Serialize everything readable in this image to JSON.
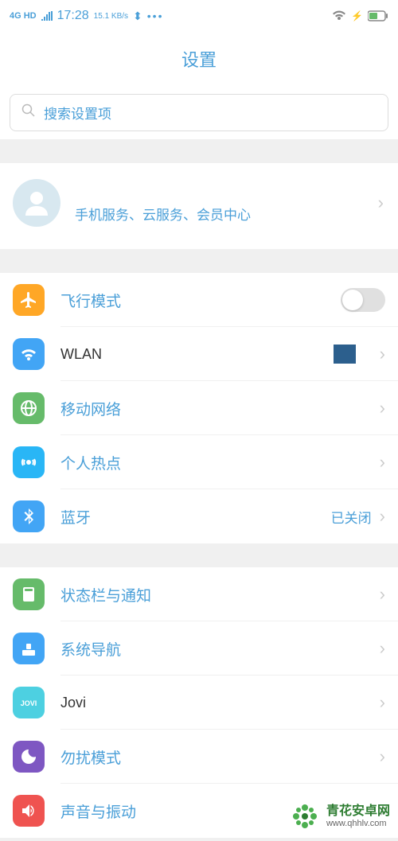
{
  "status": {
    "signal": "4G HD",
    "time": "17:28",
    "speed": "15.1 KB/s",
    "usb": "⬍",
    "more": "•••"
  },
  "header": {
    "title": "设置"
  },
  "search": {
    "placeholder": "搜索设置项"
  },
  "account": {
    "subtitle": "手机服务、云服务、会员中心"
  },
  "groups": [
    {
      "items": [
        {
          "id": "airplane",
          "label": "飞行模式",
          "type": "toggle",
          "enabled": false
        },
        {
          "id": "wlan",
          "label": "WLAN",
          "type": "nav",
          "badge": true,
          "plain": true
        },
        {
          "id": "mobile",
          "label": "移动网络",
          "type": "nav"
        },
        {
          "id": "hotspot",
          "label": "个人热点",
          "type": "nav"
        },
        {
          "id": "bluetooth",
          "label": "蓝牙",
          "type": "nav",
          "value": "已关闭"
        }
      ]
    },
    {
      "items": [
        {
          "id": "status",
          "label": "状态栏与通知",
          "type": "nav"
        },
        {
          "id": "nav",
          "label": "系统导航",
          "type": "nav"
        },
        {
          "id": "jovi",
          "label": "Jovi",
          "type": "nav",
          "plain": true
        },
        {
          "id": "dnd",
          "label": "勿扰模式",
          "type": "nav"
        },
        {
          "id": "sound",
          "label": "声音与振动",
          "type": "nav"
        }
      ]
    }
  ],
  "watermark": {
    "title": "青花安卓网",
    "url": "www.qhhlv.com"
  }
}
